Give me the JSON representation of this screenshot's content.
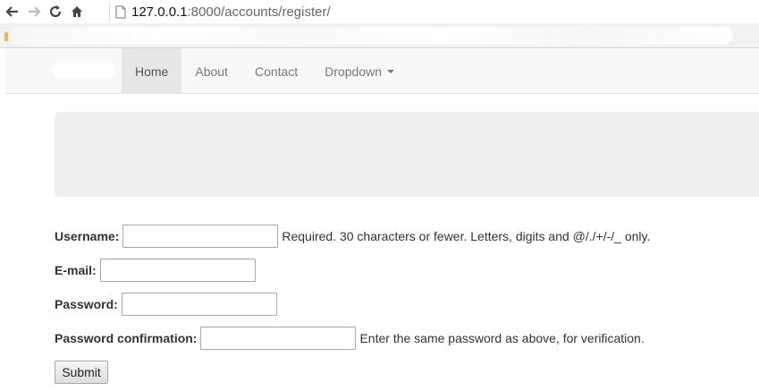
{
  "browser": {
    "url_host": "127.0.0.1",
    "url_path": ":8000/accounts/register/"
  },
  "navbar": {
    "items": [
      {
        "label": "Home",
        "active": true
      },
      {
        "label": "About"
      },
      {
        "label": "Contact"
      },
      {
        "label": "Dropdown"
      }
    ]
  },
  "form": {
    "username_label": "Username:",
    "username_help": "Required. 30 characters or fewer. Letters, digits and @/./+/-/_ only.",
    "email_label": "E-mail:",
    "password_label": "Password:",
    "password_confirm_label": "Password confirmation:",
    "password_confirm_help": "Enter the same password as above, for verification.",
    "submit_label": "Submit"
  },
  "icons": [
    "back-arrow-icon",
    "forward-arrow-icon",
    "reload-icon",
    "home-icon",
    "page-icon",
    "caret-down-icon"
  ]
}
